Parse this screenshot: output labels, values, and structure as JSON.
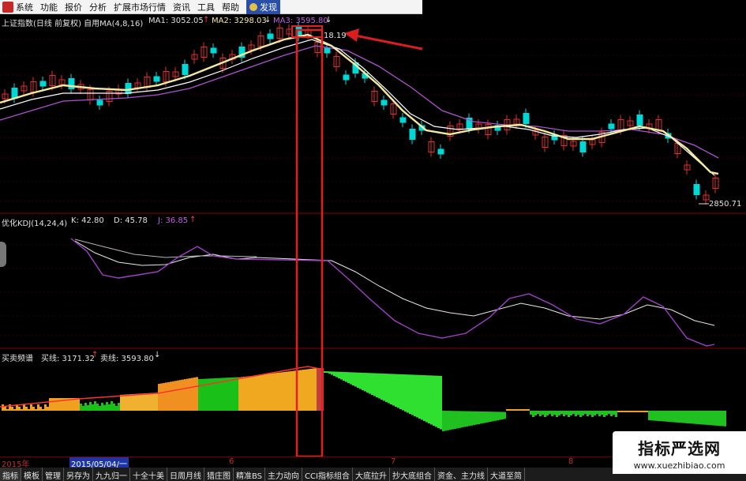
{
  "menu": [
    "系统",
    "功能",
    "报价",
    "分析",
    "扩展市场行情",
    "资讯",
    "工具",
    "帮助"
  ],
  "menu_active": "发现",
  "main_panel": {
    "title": "上证指数(日线 前复权) 自用MA(4,8,16)",
    "ma1": "MA1: 3052.05",
    "ma2": "MA2: 3298.03",
    "ma3": "MA3: 3595.80",
    "high_label": "18.19",
    "low_label": "2850.71"
  },
  "kdj_panel": {
    "title": "优化KDJ(14,24,4)",
    "k": "K: 42.80",
    "d": "D: 45.78",
    "j": "J: 36.85"
  },
  "spectrum_panel": {
    "title": "买卖频谱",
    "buy": "买线: 3171.32",
    "sell": "卖线: 3593.80"
  },
  "timebar": {
    "year": "2015年",
    "selected_date": "2015/05/04/一",
    "m6": "6",
    "m7": "7",
    "m8": "8"
  },
  "tabs": [
    "指标",
    "模板",
    "管理",
    "另存为",
    "九九归一",
    "十全十美",
    "日周月线",
    "猎庄图",
    "精准BS",
    "主力动向",
    "CCI指标组合",
    "大底拉升",
    "抄大底组合",
    "资金、主力线",
    "大道至简"
  ],
  "watermark": {
    "cn": "指标严选网",
    "en": "www.xuezhibiao.com"
  },
  "colors": {
    "up": "#e03030",
    "down": "#00d8d8",
    "ma_yellow": "#f3e9a0",
    "ma_purple": "#c060e0",
    "highlight_box": "#e02020"
  }
}
